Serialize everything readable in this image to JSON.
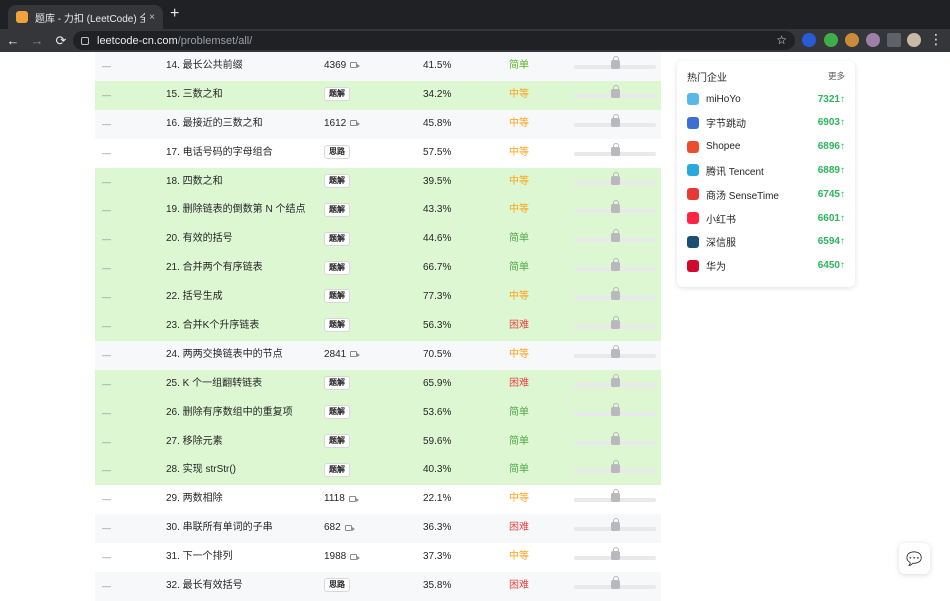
{
  "browser": {
    "tab_title": "题库 - 力扣 (LeetCode) 全球极客",
    "tab_close": "×",
    "new_tab": "+",
    "back": "←",
    "forward": "→",
    "reload": "⟳",
    "url_host": "leetcode-cn.com",
    "url_path": "/problemset/all/",
    "bookmark": "☆",
    "menu": "⋮"
  },
  "problems": [
    {
      "status": "—",
      "title": "14. 最长公共前缀",
      "solution": "4369",
      "has_video": true,
      "tag": "",
      "rate": "41.5%",
      "difficulty": "简单",
      "level": "easy",
      "solved": false
    },
    {
      "status": "—",
      "title": "15. 三数之和",
      "solution": "",
      "has_video": false,
      "tag": "题解",
      "rate": "34.2%",
      "difficulty": "中等",
      "level": "med",
      "solved": true
    },
    {
      "status": "—",
      "title": "16. 最接近的三数之和",
      "solution": "1612",
      "has_video": true,
      "tag": "",
      "rate": "45.8%",
      "difficulty": "中等",
      "level": "med",
      "solved": false
    },
    {
      "status": "—",
      "title": "17. 电话号码的字母组合",
      "solution": "",
      "has_video": false,
      "tag": "思路",
      "rate": "57.5%",
      "difficulty": "中等",
      "level": "med",
      "solved": false
    },
    {
      "status": "—",
      "title": "18. 四数之和",
      "solution": "",
      "has_video": false,
      "tag": "题解",
      "rate": "39.5%",
      "difficulty": "中等",
      "level": "med",
      "solved": true
    },
    {
      "status": "—",
      "title": "19. 删除链表的倒数第 N 个结点",
      "solution": "",
      "has_video": false,
      "tag": "题解",
      "rate": "43.3%",
      "difficulty": "中等",
      "level": "med",
      "solved": true
    },
    {
      "status": "—",
      "title": "20. 有效的括号",
      "solution": "",
      "has_video": false,
      "tag": "题解",
      "rate": "44.6%",
      "difficulty": "简单",
      "level": "easy",
      "solved": true
    },
    {
      "status": "—",
      "title": "21. 合并两个有序链表",
      "solution": "",
      "has_video": false,
      "tag": "题解",
      "rate": "66.7%",
      "difficulty": "简单",
      "level": "easy",
      "solved": true
    },
    {
      "status": "—",
      "title": "22. 括号生成",
      "solution": "",
      "has_video": false,
      "tag": "题解",
      "rate": "77.3%",
      "difficulty": "中等",
      "level": "med",
      "solved": true
    },
    {
      "status": "—",
      "title": "23. 合并K个升序链表",
      "solution": "",
      "has_video": false,
      "tag": "题解",
      "rate": "56.3%",
      "difficulty": "困难",
      "level": "hard",
      "solved": true
    },
    {
      "status": "—",
      "title": "24. 两两交换链表中的节点",
      "solution": "2841",
      "has_video": true,
      "tag": "",
      "rate": "70.5%",
      "difficulty": "中等",
      "level": "med",
      "solved": false
    },
    {
      "status": "—",
      "title": "25. K 个一组翻转链表",
      "solution": "",
      "has_video": false,
      "tag": "题解",
      "rate": "65.9%",
      "difficulty": "困难",
      "level": "hard",
      "solved": true
    },
    {
      "status": "—",
      "title": "26. 删除有序数组中的重复项",
      "solution": "",
      "has_video": false,
      "tag": "题解",
      "rate": "53.6%",
      "difficulty": "简单",
      "level": "easy",
      "solved": true
    },
    {
      "status": "—",
      "title": "27. 移除元素",
      "solution": "",
      "has_video": false,
      "tag": "题解",
      "rate": "59.6%",
      "difficulty": "简单",
      "level": "easy",
      "solved": true
    },
    {
      "status": "—",
      "title": "28. 实现 strStr()",
      "solution": "",
      "has_video": false,
      "tag": "题解",
      "rate": "40.3%",
      "difficulty": "简单",
      "level": "easy",
      "solved": true
    },
    {
      "status": "—",
      "title": "29. 两数相除",
      "solution": "1118",
      "has_video": true,
      "tag": "",
      "rate": "22.1%",
      "difficulty": "中等",
      "level": "med",
      "solved": false
    },
    {
      "status": "—",
      "title": "30. 串联所有单词的子串",
      "solution": "682",
      "has_video": true,
      "tag": "",
      "rate": "36.3%",
      "difficulty": "困难",
      "level": "hard",
      "solved": false
    },
    {
      "status": "—",
      "title": "31. 下一个排列",
      "solution": "1988",
      "has_video": true,
      "tag": "",
      "rate": "37.3%",
      "difficulty": "中等",
      "level": "med",
      "solved": false
    },
    {
      "status": "—",
      "title": "32. 最长有效括号",
      "solution": "",
      "has_video": false,
      "tag": "思路",
      "rate": "35.8%",
      "difficulty": "困难",
      "level": "hard",
      "solved": false
    }
  ],
  "companies": {
    "title": "热门企业",
    "more": "更多",
    "items": [
      {
        "name": "miHoYo",
        "count": "7321",
        "color": "#58b8e8"
      },
      {
        "name": "字节跳动",
        "count": "6903",
        "color": "#3c6fd4"
      },
      {
        "name": "Shopee",
        "count": "6896",
        "color": "#ee4d2d"
      },
      {
        "name": "腾讯 Tencent",
        "count": "6889",
        "color": "#2aa8e0"
      },
      {
        "name": "商汤 SenseTime",
        "count": "6745",
        "color": "#e53935"
      },
      {
        "name": "小红书",
        "count": "6601",
        "color": "#ff2442"
      },
      {
        "name": "深信服",
        "count": "6594",
        "color": "#1b4f72"
      },
      {
        "name": "华为",
        "count": "6450",
        "color": "#cf0a2c"
      }
    ],
    "arrow": "↑"
  }
}
